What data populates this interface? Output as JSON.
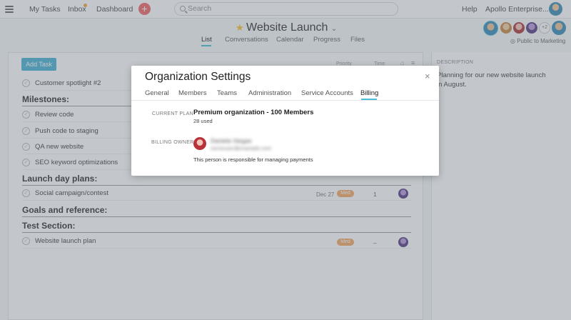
{
  "topbar": {
    "nav": [
      "My Tasks",
      "Inbox",
      "Dashboard"
    ],
    "search_placeholder": "Search",
    "help": "Help",
    "org": "Apollo Enterprise..."
  },
  "project": {
    "title": "Website Launch",
    "tabs": [
      "List",
      "Conversations",
      "Calendar",
      "Progress",
      "Files"
    ],
    "active_tab": "List",
    "extra_members": "+2",
    "visibility": "Public to Marketing"
  },
  "list": {
    "add_task": "Add Task",
    "rows": [
      {
        "kind": "task",
        "name": "Customer spotlight #2"
      },
      {
        "kind": "section",
        "name": "Milestones:"
      },
      {
        "kind": "task",
        "name": "Review code"
      },
      {
        "kind": "task",
        "name": "Push code to staging"
      },
      {
        "kind": "task",
        "name": "QA new website"
      },
      {
        "kind": "task",
        "name": "SEO keyword optimizations"
      },
      {
        "kind": "section",
        "name": "Launch day plans:"
      },
      {
        "kind": "task",
        "name": "Social campaign/contest",
        "due": "Dec 27",
        "priority": "Med",
        "count": "1"
      },
      {
        "kind": "section",
        "name": "Goals and reference:"
      },
      {
        "kind": "section",
        "name": "Test Section:"
      },
      {
        "kind": "task",
        "name": "Website launch plan",
        "priority": "Med",
        "count": "–"
      }
    ]
  },
  "description": {
    "label": "DESCRIPTION",
    "text": "Planning for our new website launch in August."
  },
  "modal": {
    "title": "Organization Settings",
    "close": "×",
    "tabs": [
      "General",
      "Members",
      "Teams",
      "Administration",
      "Service Accounts",
      "Billing"
    ],
    "active_tab": "Billing",
    "current_plan_label": "CURRENT PLAN",
    "plan": "Premium organization - 100 Members",
    "used": "28 used",
    "billing_owner_label": "BILLING OWNER",
    "owner_name": "Daniela Vargas",
    "owner_email": "someuser@example.com",
    "responsible": "This person is responsible for managing payments"
  },
  "colors": {
    "accent": "#4bbed6",
    "add_button": "#4bb4d4",
    "priority_med": "#f6a866",
    "plus": "#f06a6a"
  }
}
